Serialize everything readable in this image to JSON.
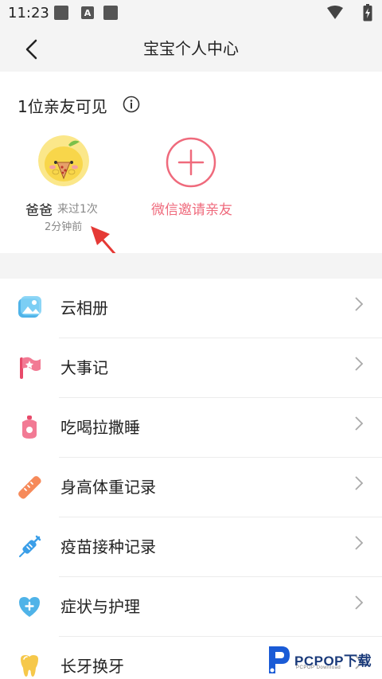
{
  "status_bar": {
    "time": "11:23",
    "icons": [
      "image-icon",
      "a-notification-icon",
      "image-icon",
      "wifi-icon",
      "battery-charging-icon"
    ]
  },
  "header": {
    "title": "宝宝个人中心",
    "back_icon": "chevron-left-icon"
  },
  "family": {
    "visible_title": "1位亲友可见",
    "members": [
      {
        "name": "爸爸",
        "visits": "来过1次",
        "last_seen": "2分钟前",
        "avatar_icon": "lemon-avatar-icon"
      }
    ],
    "invite_label": "微信邀请亲友",
    "accent_color": "#ef6a7c"
  },
  "menu": {
    "items": [
      {
        "label": "云相册",
        "icon": "photo-album-icon"
      },
      {
        "label": "大事记",
        "icon": "flag-icon"
      },
      {
        "label": "吃喝拉撒睡",
        "icon": "baby-bottle-icon"
      },
      {
        "label": "身高体重记录",
        "icon": "ruler-icon"
      },
      {
        "label": "疫苗接种记录",
        "icon": "syringe-icon"
      },
      {
        "label": "症状与护理",
        "icon": "heart-plus-icon"
      },
      {
        "label": "长牙换牙",
        "icon": "tooth-icon"
      }
    ]
  },
  "watermark": {
    "text": "PCPOP下载",
    "sub": "PCPOP Download"
  }
}
